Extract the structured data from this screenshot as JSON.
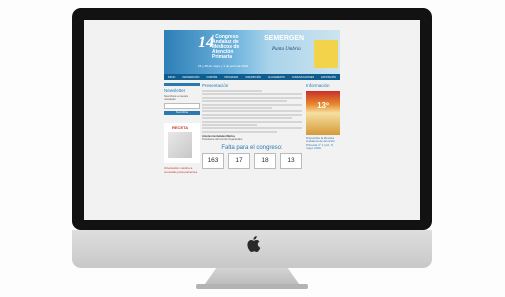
{
  "site": {
    "banner": {
      "edition": "14",
      "congress_title": "º Congreso Andaluz de Médicos de Atención Primaria",
      "dates": "16 y 18 de mayo y 1 de junio de 2019",
      "brand": "SEMERGEN",
      "brand_region": "Andalucía",
      "city": "Punta Umbría"
    },
    "nav": [
      "INICIO",
      "INFORMACIÓN",
      "COMITÉS",
      "PROGRAMA",
      "INSCRIPCIÓN",
      "ALOJAMIENTO",
      "COMUNICACIONES",
      "EXPOSICIÓN"
    ],
    "sidebar": {
      "newsletter_title": "Newsletter",
      "newsletter_text": "Suscríbete a nuestra newsletter",
      "email_placeholder": "Introduce tu e-mail",
      "subscribe_label": "Suscribirse",
      "receta_title": "RECETA",
      "footer_text": "Orientación médica a consultas para pacientes"
    },
    "main": {
      "title": "Presentación",
      "signature_name": "Antonio Hernández Martos",
      "signature_role": "Presidente del Comité Organizador",
      "countdown_title": "Falta para el congreso:",
      "countdown": [
        "163",
        "17",
        "18",
        "13"
      ]
    },
    "right": {
      "title": "Información",
      "doc_caption": "13º",
      "news_text": "Disponible la Revista Andaluza de Atención Primaria nº 1 (vol. 7) mayo 2019"
    }
  }
}
